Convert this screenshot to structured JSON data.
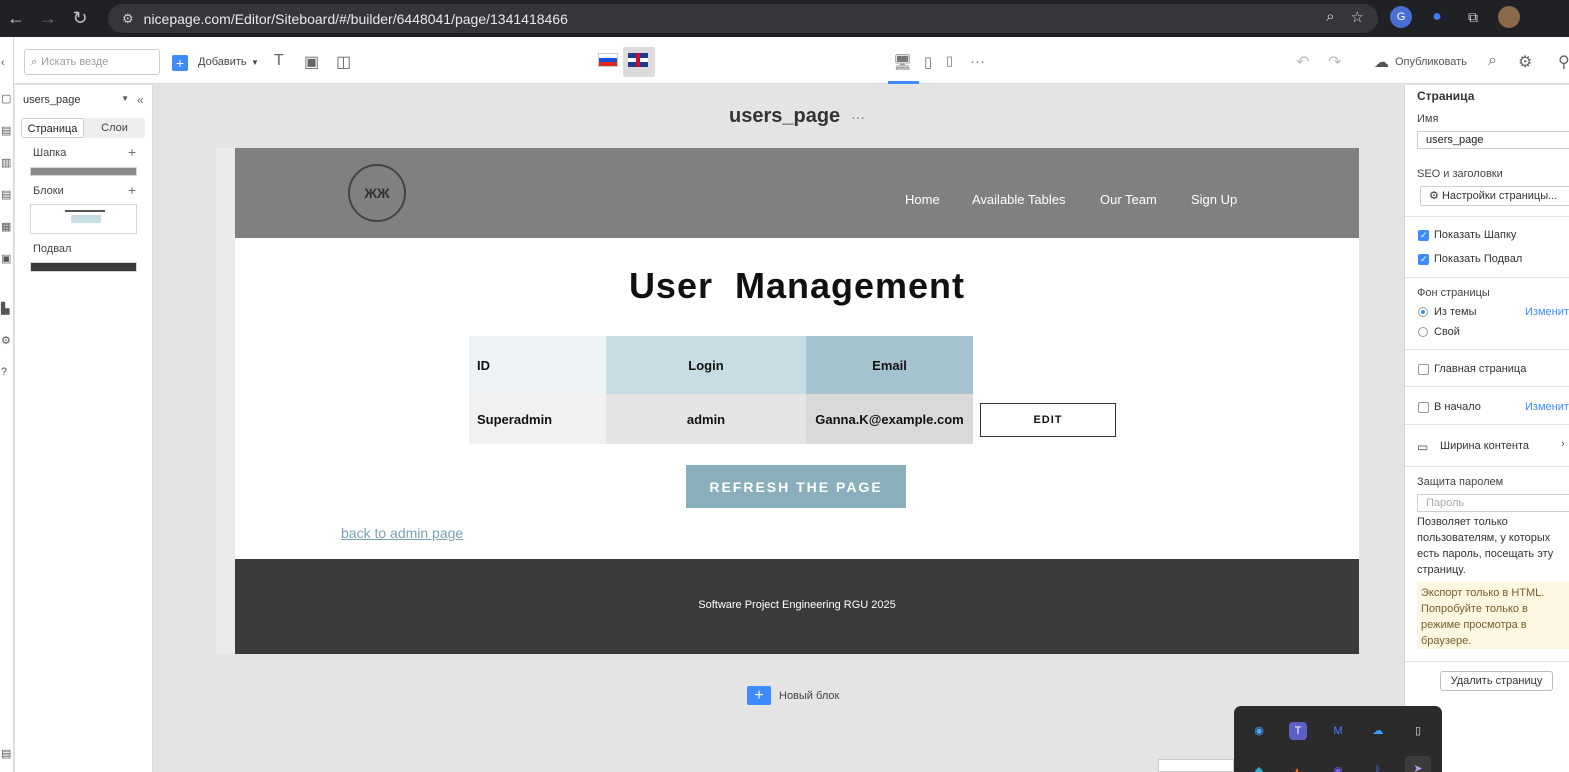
{
  "browser": {
    "url": "nicepage.com/Editor/Siteboard/#/builder/6448041/page/1341418466"
  },
  "toolbar": {
    "search_placeholder": "Искать везде",
    "add_label": "Добавить",
    "publish_label": "Опубликовать"
  },
  "left_panel": {
    "page_select": "users_page",
    "tabs": [
      "Страница",
      "Слои"
    ],
    "sections": {
      "header": "Шапка",
      "blocks": "Блоки",
      "footer": "Подвал"
    }
  },
  "canvas": {
    "page_name": "users_page",
    "page_menu": "···",
    "new_block": "Новый блок"
  },
  "site": {
    "nav": [
      "Home",
      "Available Tables",
      "Our Team",
      "Sign Up"
    ],
    "heading": "User  Management",
    "table": {
      "headers": [
        "ID",
        "Login",
        "Email"
      ],
      "rows": [
        [
          "Superadmin",
          "admin",
          "Ganna.K@example.com"
        ]
      ]
    },
    "edit_button": "EDIT",
    "refresh_button": "REFRESH THE PAGE",
    "back_link": "back to admin page",
    "footer_text": "Software Project Engineering RGU 2025"
  },
  "right_panel": {
    "title": "Страница",
    "name_label": "Имя",
    "name_value": "users_page",
    "seo_label": "SEO и заголовки",
    "seo_button": "Настройки страницы...",
    "show_header": "Показать Шапку",
    "show_footer": "Показать Подвал",
    "background_label": "Фон страницы",
    "bg_theme": "Из темы",
    "bg_custom": "Свой",
    "change_link": "Изменить",
    "home_page": "Главная страница",
    "to_top": "В начало",
    "change_link_2": "Изменить",
    "content_width": "Ширина контента",
    "password_label": "Защита паролем",
    "password_placeholder": "Пароль",
    "password_desc": "Позволяет только пользователям, у которых есть пароль, посещать эту страницу.",
    "export_warning": "Экспорт только в HTML. Попробуйте только в режиме просмотра в браузере.",
    "delete_button": "Удалить страницу"
  },
  "colors": {
    "accent": "#3d8bfd",
    "header_gray": "#808080",
    "button_blue": "#8aaebc",
    "footer_dark": "#3a3a3a"
  }
}
